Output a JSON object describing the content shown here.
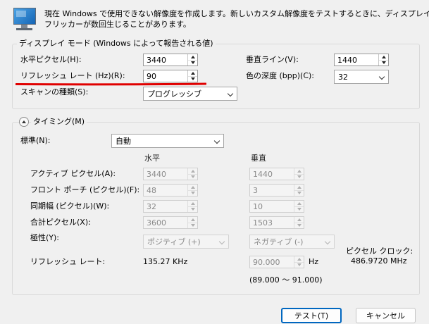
{
  "header": {
    "description": "現在 Windows で使用できない解像度を作成します。新しいカスタム解像度をテストするときに、ディスプレイで\nフリッカーが数回生じることがあります。"
  },
  "display_mode": {
    "title": "ディスプレイ モード (Windows によって報告される値)",
    "h_pixels_label": "水平ピクセル(H):",
    "h_pixels_value": "3440",
    "v_lines_label": "垂直ライン(V):",
    "v_lines_value": "1440",
    "refresh_label": "リフレッシュ レート (Hz)(R):",
    "refresh_value": "90",
    "color_depth_label": "色の深度 (bpp)(C):",
    "color_depth_value": "32",
    "scan_type_label": "スキャンの種類(S):",
    "scan_type_value": "プログレッシブ"
  },
  "timing": {
    "title": "タイミング(M)",
    "standard_label": "標準(N):",
    "standard_value": "自動",
    "col_horizontal": "水平",
    "col_vertical": "垂直",
    "rows": [
      {
        "label": "アクティブ ピクセル(A):",
        "h": "3440",
        "v": "1440"
      },
      {
        "label": "フロント ポーチ (ピクセル)(F):",
        "h": "48",
        "v": "3"
      },
      {
        "label": "同期幅 (ピクセル)(W):",
        "h": "32",
        "v": "10"
      },
      {
        "label": "合計ピクセル(X):",
        "h": "3600",
        "v": "1503"
      }
    ],
    "polarity_label": "極性(Y):",
    "polarity_h": "ポジティブ (+)",
    "polarity_v": "ネガティブ (-)",
    "refresh_label": "リフレッシュ レート:",
    "refresh_h_value": "135.27 KHz",
    "refresh_v_value": "90.000",
    "refresh_unit": "Hz",
    "refresh_range": "(89.000 ～ 91.000)",
    "pixel_clock_label": "ピクセル クロック:",
    "pixel_clock_value": "486.9720 MHz"
  },
  "buttons": {
    "test": "テスト(T)",
    "cancel": "キャンセル"
  },
  "colors": {
    "annotation": "#e00000",
    "primary_border": "#0067c0"
  }
}
